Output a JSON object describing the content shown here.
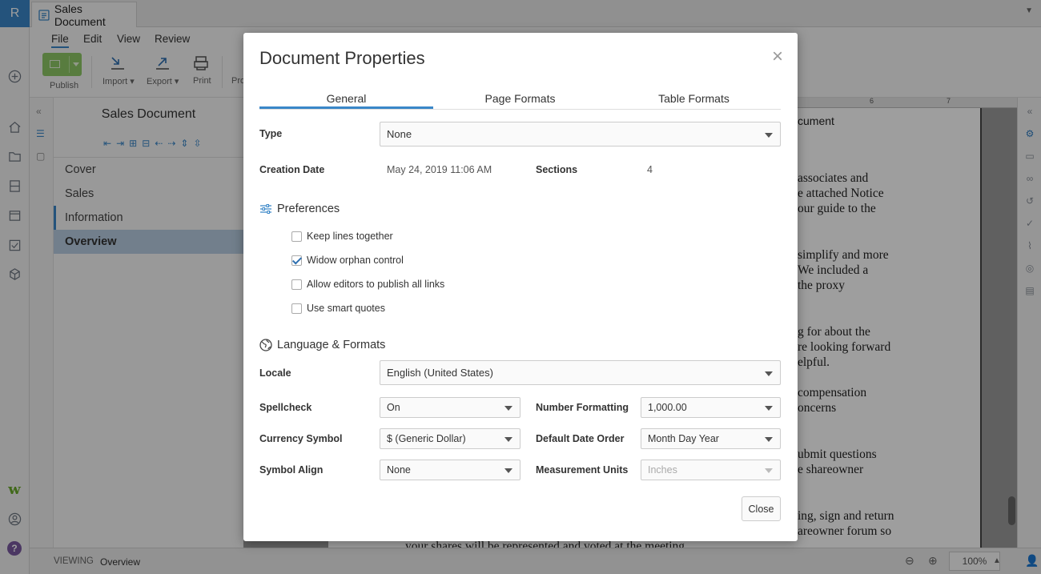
{
  "app": {
    "brand_letter": "R",
    "document_tab": "Sales Document"
  },
  "menu": [
    "File",
    "Edit",
    "View",
    "Review"
  ],
  "ribbon": {
    "publish": "Publish",
    "import": "Import",
    "export": "Export",
    "print": "Print",
    "truncated": "Pro"
  },
  "outline": {
    "title": "Sales Document",
    "items": [
      "Cover",
      "Sales",
      "Information",
      "Overview"
    ],
    "selected": "Overview"
  },
  "ruler": {
    "marks": [
      "6",
      "7"
    ]
  },
  "document_fragments": [
    "cument",
    "associates and",
    "e attached Notice",
    "our guide to the",
    "simplify and more",
    "We included a",
    "the proxy",
    "g for about the",
    "re looking forward",
    "elpful.",
    "compensation",
    "oncerns",
    "ubmit questions",
    "e shareowner",
    "ing, sign and return",
    "areowner forum so",
    "your shares will be represented and voted at the meeting."
  ],
  "status": {
    "mode": "VIEWING",
    "section": "Overview",
    "zoom": "100%"
  },
  "dialog": {
    "title": "Document Properties",
    "tabs": [
      "General",
      "Page Formats",
      "Table Formats"
    ],
    "active_tab": "General",
    "type": {
      "label": "Type",
      "value": "None"
    },
    "creation_date": {
      "label": "Creation Date",
      "value": "May 24, 2019 11:06 AM"
    },
    "sections": {
      "label": "Sections",
      "value": "4"
    },
    "preferences": {
      "heading": "Preferences",
      "options": [
        {
          "label": "Keep lines together",
          "checked": false
        },
        {
          "label": "Widow orphan control",
          "checked": true
        },
        {
          "label": "Allow editors to publish all links",
          "checked": false
        },
        {
          "label": "Use smart quotes",
          "checked": false
        }
      ]
    },
    "language": {
      "heading": "Language & Formats",
      "locale": {
        "label": "Locale",
        "value": "English (United States)"
      },
      "spellcheck": {
        "label": "Spellcheck",
        "value": "On"
      },
      "number_formatting": {
        "label": "Number Formatting",
        "value": "1,000.00"
      },
      "currency_symbol": {
        "label": "Currency Symbol",
        "value": "$ (Generic Dollar)"
      },
      "default_date_order": {
        "label": "Default Date Order",
        "value": "Month Day Year"
      },
      "symbol_align": {
        "label": "Symbol Align",
        "value": "None"
      },
      "measurement_units": {
        "label": "Measurement Units",
        "value": "Inches"
      }
    },
    "close_button": "Close"
  },
  "colors": {
    "accent": "#3a87c8",
    "publish": "#8fc966",
    "selected_item": "#b9cee2"
  }
}
